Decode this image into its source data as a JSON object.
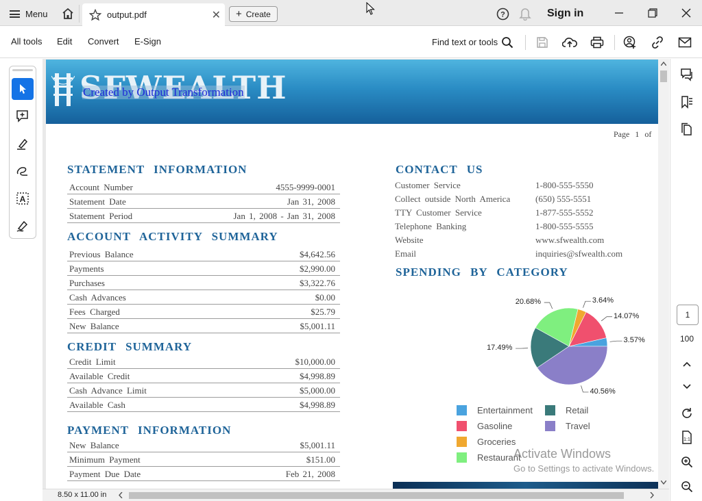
{
  "titlebar": {
    "menu_label": "Menu",
    "tab_title": "output.pdf",
    "create_label": "Create",
    "signin_label": "Sign in"
  },
  "toolbar": {
    "menus": [
      "All tools",
      "Edit",
      "Convert",
      "E-Sign"
    ],
    "find_label": "Find text or tools"
  },
  "document": {
    "logo_text": "SFWEALTH",
    "overlay_text": "Created by Output Transformation",
    "page_indicator": "Page 1 of",
    "statement": {
      "heading": "STATEMENT INFORMATION",
      "rows": [
        {
          "k": "Account Number",
          "v": "4555-9999-0001"
        },
        {
          "k": "Statement Date",
          "v": "Jan 31, 2008"
        },
        {
          "k": "Statement Period",
          "v": "Jan 1, 2008 - Jan 31, 2008"
        }
      ]
    },
    "activity": {
      "heading": "ACCOUNT ACTIVITY SUMMARY",
      "rows": [
        {
          "k": "Previous Balance",
          "v": "$4,642.56"
        },
        {
          "k": "Payments",
          "v": "$2,990.00"
        },
        {
          "k": "Purchases",
          "v": "$3,322.76"
        },
        {
          "k": "Cash Advances",
          "v": "$0.00"
        },
        {
          "k": "Fees Charged",
          "v": "$25.79"
        },
        {
          "k": "New Balance",
          "v": "$5,001.11"
        }
      ]
    },
    "credit": {
      "heading": "CREDIT SUMMARY",
      "rows": [
        {
          "k": "Credit Limit",
          "v": "$10,000.00"
        },
        {
          "k": "Available Credit",
          "v": "$4,998.89"
        },
        {
          "k": "Cash Advance Limit",
          "v": "$5,000.00"
        },
        {
          "k": "Available Cash",
          "v": "$4,998.89"
        }
      ]
    },
    "payment": {
      "heading": "PAYMENT INFORMATION",
      "rows": [
        {
          "k": "New Balance",
          "v": "$5,001.11"
        },
        {
          "k": "Minimum Payment",
          "v": "$151.00"
        },
        {
          "k": "Payment Due Date",
          "v": "Feb 21, 2008"
        }
      ]
    },
    "contact": {
      "heading": "CONTACT US",
      "rows": [
        {
          "k": "Customer Service",
          "v": "1-800-555-5550"
        },
        {
          "k": "Collect outside North America",
          "v": "(650) 555-5551"
        },
        {
          "k": "TTY Customer Service",
          "v": "1-877-555-5552"
        },
        {
          "k": "Telephone Banking",
          "v": "1-800-555-5555"
        },
        {
          "k": "Website",
          "v": "www.sfwealth.com"
        },
        {
          "k": "Email",
          "v": "inquiries@sfwealth.com"
        }
      ]
    },
    "spending_heading": "SPENDING BY CATEGORY"
  },
  "chart_data": {
    "type": "pie",
    "categories": [
      "Entertainment",
      "Gasoline",
      "Groceries",
      "Restaurant",
      "Retail",
      "Travel"
    ],
    "values": [
      3.57,
      14.07,
      3.64,
      20.68,
      17.49,
      40.56
    ],
    "labels": [
      "3.57%",
      "14.07%",
      "3.64%",
      "20.68%",
      "17.49%",
      "40.56%"
    ],
    "colors": [
      "#4aa3df",
      "#f0506e",
      "#f0a830",
      "#7fef7f",
      "#3a7a7a",
      "#8a7fc8"
    ],
    "legend_position": "bottom"
  },
  "watermark": {
    "line1": "Activate Windows",
    "line2": "Go to Settings to activate Windows."
  },
  "statusbar": {
    "page_size": "8.50 x 11.00 in"
  },
  "right_rail": {
    "current_page": "1",
    "zoom": "100"
  },
  "colors": {
    "accent": "#1473e6",
    "heading_blue": "#1f6499"
  }
}
